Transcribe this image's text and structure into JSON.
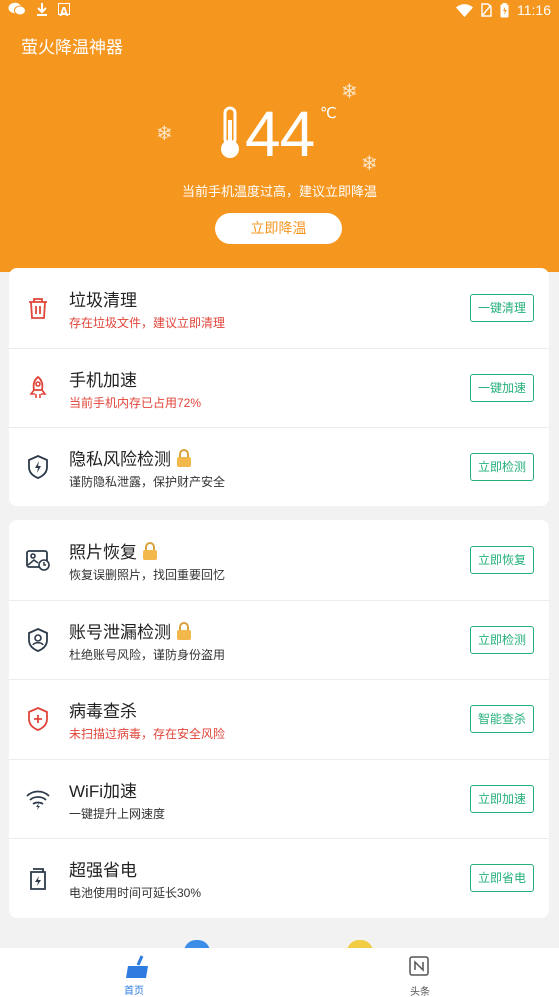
{
  "status_bar": {
    "time": "11:16"
  },
  "header": {
    "app_title": "萤火降温神器",
    "temperature": "44",
    "temperature_unit": "℃",
    "hint": "当前手机温度过高，建议立即降温",
    "cool_button": "立即降温"
  },
  "colors": {
    "brand_orange": "#f5961f",
    "action_green": "#25b07a",
    "warn_red": "#e0453a",
    "nav_blue": "#2f7be0"
  },
  "card1": {
    "items": [
      {
        "icon": "trash-icon",
        "title": "垃圾清理",
        "subtitle": "存在垃圾文件，建议立即清理",
        "warn": true,
        "locked": false,
        "action": "一键清理"
      },
      {
        "icon": "rocket-icon",
        "title": "手机加速",
        "subtitle": "当前手机内存已占用72%",
        "warn": true,
        "locked": false,
        "action": "一键加速"
      },
      {
        "icon": "shield-lightning-icon",
        "title": "隐私风险检测",
        "subtitle": "谨防隐私泄露，保护财产安全",
        "warn": false,
        "locked": true,
        "action": "立即检测"
      }
    ]
  },
  "card2": {
    "items": [
      {
        "icon": "photo-restore-icon",
        "title": "照片恢复",
        "subtitle": "恢复误删照片，找回重要回忆",
        "warn": false,
        "locked": true,
        "action": "立即恢复"
      },
      {
        "icon": "shield-user-icon",
        "title": "账号泄漏检测",
        "subtitle": "杜绝账号风险，谨防身份盗用",
        "warn": false,
        "locked": true,
        "action": "立即检测"
      },
      {
        "icon": "shield-plus-icon",
        "title": "病毒查杀",
        "subtitle": "未扫描过病毒，存在安全风险",
        "warn": true,
        "locked": false,
        "action": "智能查杀"
      },
      {
        "icon": "wifi-boost-icon",
        "title": "WiFi加速",
        "subtitle": "一键提升上网速度",
        "warn": false,
        "locked": false,
        "action": "立即加速"
      },
      {
        "icon": "battery-charge-icon",
        "title": "超强省电",
        "subtitle": "电池使用时间可延长30%",
        "warn": false,
        "locked": false,
        "action": "立即省电"
      }
    ]
  },
  "bottom_nav": {
    "home_label": "首页",
    "news_label": "头条"
  }
}
